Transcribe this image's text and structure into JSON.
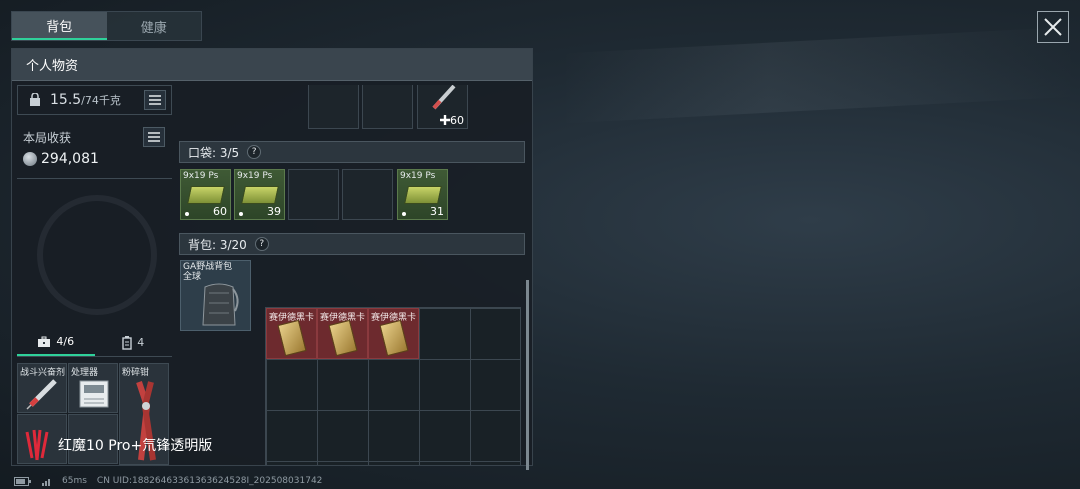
{
  "tabs": [
    {
      "label": "背包",
      "active": true
    },
    {
      "label": "健康",
      "active": false
    }
  ],
  "panel": {
    "title": "个人物资"
  },
  "weight": {
    "current": "15.5",
    "max": "/74千克"
  },
  "gains": {
    "label": "本局收获",
    "value": "294,081"
  },
  "top_slot": {
    "count": "60"
  },
  "pocket": {
    "label": "口袋: 3/5",
    "help": "?",
    "items": [
      {
        "name": "9x19 Ps",
        "count": "60"
      },
      {
        "name": "9x19 Ps",
        "count": "39"
      },
      {
        "name": "9x19 Ps",
        "count": "31"
      }
    ]
  },
  "backpack": {
    "label": "背包: 3/20",
    "help": "?",
    "bag_name": "GA野战背包 全球",
    "cards": [
      {
        "label": "赛伊德黑卡"
      },
      {
        "label": "赛伊德黑卡"
      },
      {
        "label": "赛伊德黑卡"
      }
    ]
  },
  "tool_tabs": [
    {
      "label": "4/6",
      "icon": "toolbox-icon"
    },
    {
      "label": "4",
      "icon": "battery-icon"
    }
  ],
  "tools": [
    {
      "label": "战斗兴奋剂"
    },
    {
      "label": "处理器"
    },
    {
      "label": "粉碎钳"
    }
  ],
  "watermark": {
    "text": "红魔10 Pro+氘锋透明版"
  },
  "status": {
    "ping": "65ms",
    "uid": "CN UID:18826463361363624528I_202508031742"
  },
  "colors": {
    "accent": "#2fd19a",
    "card_red": "#6d2a2e",
    "ammo_green": "#3f5a35"
  }
}
